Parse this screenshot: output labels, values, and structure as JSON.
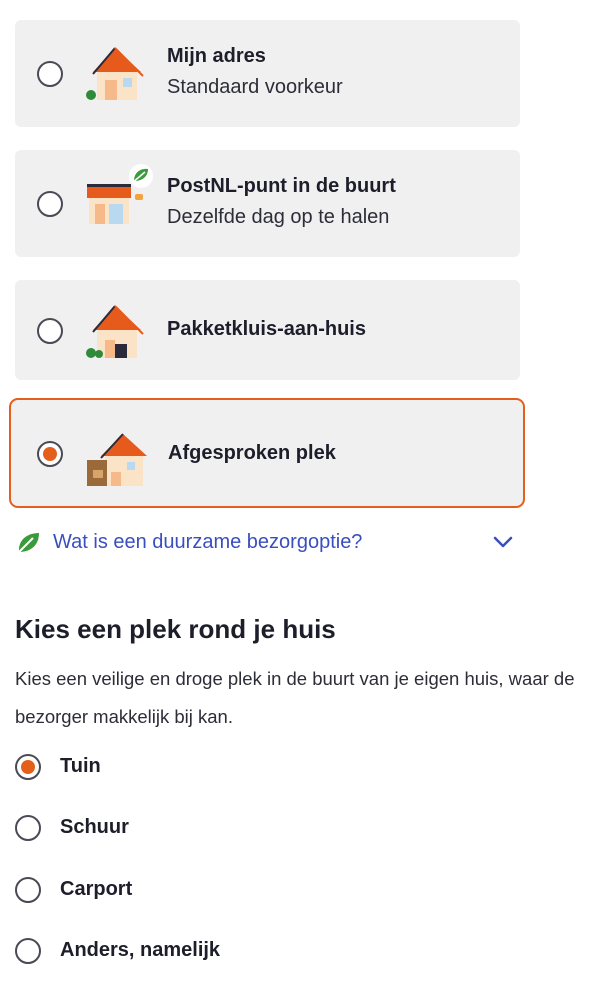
{
  "delivery_options": [
    {
      "title": "Mijn adres",
      "subtitle": "Standaard voorkeur",
      "selected": false,
      "icon": "house-icon"
    },
    {
      "title": "PostNL-punt in de buurt",
      "subtitle": "Dezelfde dag op te halen",
      "selected": false,
      "icon": "pickup-point-icon"
    },
    {
      "title": "Pakketkluis-aan-huis",
      "subtitle": "",
      "selected": false,
      "icon": "parcel-locker-icon"
    },
    {
      "title": "Afgesproken plek",
      "subtitle": "",
      "selected": true,
      "icon": "agreed-place-icon"
    }
  ],
  "info": {
    "text": "Wat is een duurzame bezorgoptie?",
    "icon": "leaf-icon",
    "expand_icon": "chevron-down-icon"
  },
  "place_section": {
    "heading": "Kies een plek rond je huis",
    "description": "Kies een veilige en droge plek in de buurt van je eigen huis, waar de bezorger makkelijk bij kan.",
    "options": [
      {
        "label": "Tuin",
        "selected": true
      },
      {
        "label": "Schuur",
        "selected": false
      },
      {
        "label": "Carport",
        "selected": false
      },
      {
        "label": "Anders, namelijk",
        "selected": false
      }
    ]
  },
  "colors": {
    "accent": "#e4601a",
    "link": "#3a4fbf",
    "card_bg": "#f0f0f1",
    "leaf": "#3b9a3b"
  }
}
